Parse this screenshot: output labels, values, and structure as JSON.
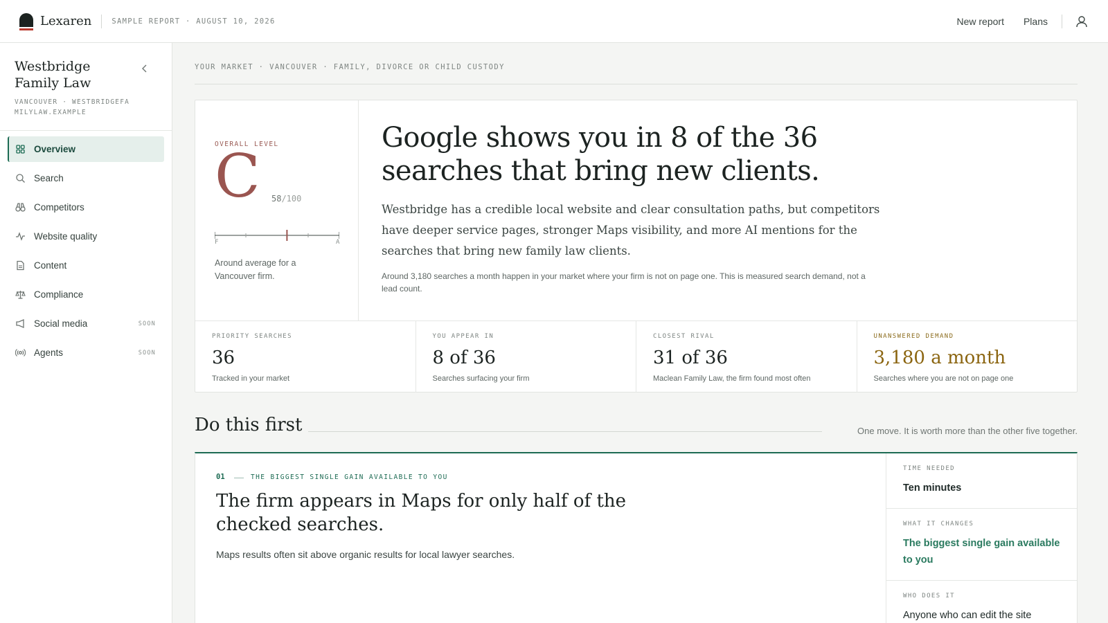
{
  "app": {
    "name": "Lexaren",
    "report_meta": "SAMPLE REPORT · AUGUST 10, 2026"
  },
  "header": {
    "links": [
      "New report",
      "Plans"
    ],
    "icons": {
      "logo": "lexaren-logo",
      "user": "user-icon"
    }
  },
  "sidebar": {
    "firm_name": "Westbridge Family Law",
    "firm_meta": "VANCOUVER · WESTBRIDGEFAMILYLAW.EXAMPLE",
    "collapse_icon": "chevron-left-icon",
    "items": [
      {
        "label": "Overview",
        "icon": "grid-icon",
        "active": true,
        "badge": ""
      },
      {
        "label": "Search",
        "icon": "search-icon",
        "active": false,
        "badge": ""
      },
      {
        "label": "Competitors",
        "icon": "binoculars-icon",
        "active": false,
        "badge": ""
      },
      {
        "label": "Website quality",
        "icon": "activity-icon",
        "active": false,
        "badge": ""
      },
      {
        "label": "Content",
        "icon": "document-icon",
        "active": false,
        "badge": ""
      },
      {
        "label": "Compliance",
        "icon": "scales-icon",
        "active": false,
        "badge": ""
      },
      {
        "label": "Social media",
        "icon": "megaphone-icon",
        "active": false,
        "badge": "SOON"
      },
      {
        "label": "Agents",
        "icon": "broadcast-icon",
        "active": false,
        "badge": "SOON"
      }
    ]
  },
  "main": {
    "breadcrumb": "YOUR MARKET · VANCOUVER · FAMILY, DIVORCE OR CHILD CUSTODY",
    "grade": {
      "label": "OVERALL LEVEL",
      "letter": "C",
      "score": "58",
      "score_max": "/100",
      "scale_min": "F",
      "scale_max": "A",
      "position_fraction": 0.58,
      "caption": "Around average for a Vancouver firm."
    },
    "headline": "Google shows you in 8 of the 36 searches that bring new clients.",
    "summary": "Westbridge has a credible local website and clear consultation paths, but competitors have deeper service pages, stronger Maps visibility, and more AI mentions for the searches that bring new family law clients.",
    "footnote": "Around 3,180 searches a month happen in your market where your firm is not on page one. This is measured search demand, not a lead count.",
    "stats": [
      {
        "label": "PRIORITY SEARCHES",
        "value": "36",
        "sub": "Tracked in your market",
        "warn": false
      },
      {
        "label": "YOU APPEAR IN",
        "value": "8 of 36",
        "sub": "Searches surfacing your firm",
        "warn": false
      },
      {
        "label": "CLOSEST RIVAL",
        "value": "31 of 36",
        "sub": "Maclean Family Law, the firm found most often",
        "warn": false
      },
      {
        "label": "UNANSWERED DEMAND",
        "value": "3,180 a month",
        "sub": "Searches where you are not on page one",
        "warn": true
      }
    ],
    "section": {
      "title": "Do this first",
      "note": "One move. It is worth more than the other five together."
    },
    "action": {
      "number": "01",
      "tag": "THE BIGGEST SINGLE GAIN AVAILABLE TO YOU",
      "title": "The firm appears in Maps for only half of the checked searches.",
      "description": "Maps results often sit above organic results for local lawyer searches.",
      "side": [
        {
          "label": "TIME NEEDED",
          "value": "Ten minutes"
        },
        {
          "label": "WHAT IT CHANGES",
          "value": "The biggest single gain available to you"
        },
        {
          "label": "WHO DOES IT",
          "value": "Anyone who can edit the site"
        }
      ]
    }
  },
  "colors": {
    "accent": "#1c6b53",
    "grade": "#9a5550",
    "warn": "#8b6510"
  }
}
